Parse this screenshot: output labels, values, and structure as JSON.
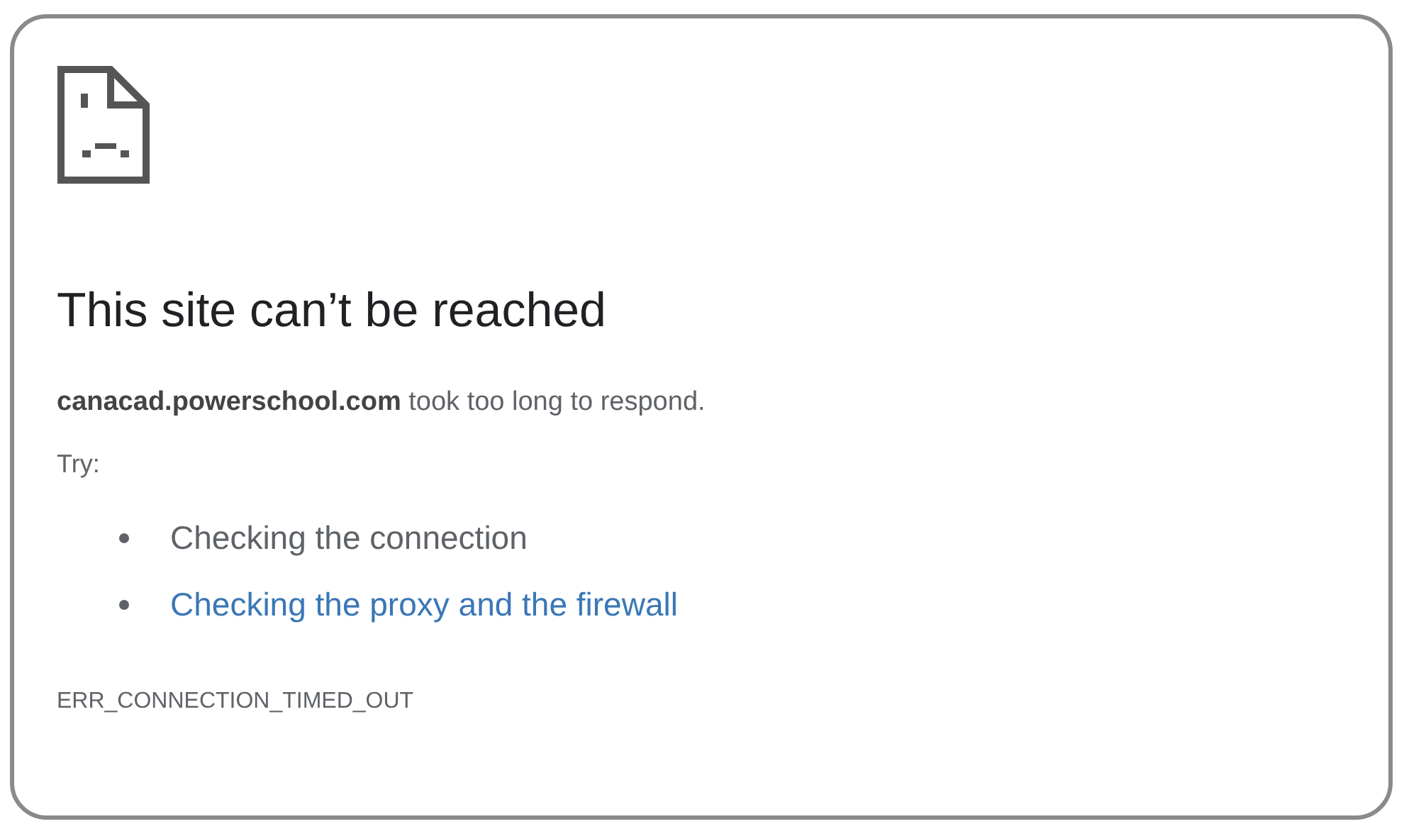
{
  "title": "This site can’t be reached",
  "message": "**canacad.powerschool.com** took too long to respond.",
  "try_label": "Try:",
  "suggestions": [
    {
      "kind": "text",
      "label": "Checking the connection"
    },
    {
      "kind": "link",
      "label": "Checking the proxy and the firewall"
    }
  ],
  "error_code": "ERR_CONNECTION_TIMED_OUT"
}
